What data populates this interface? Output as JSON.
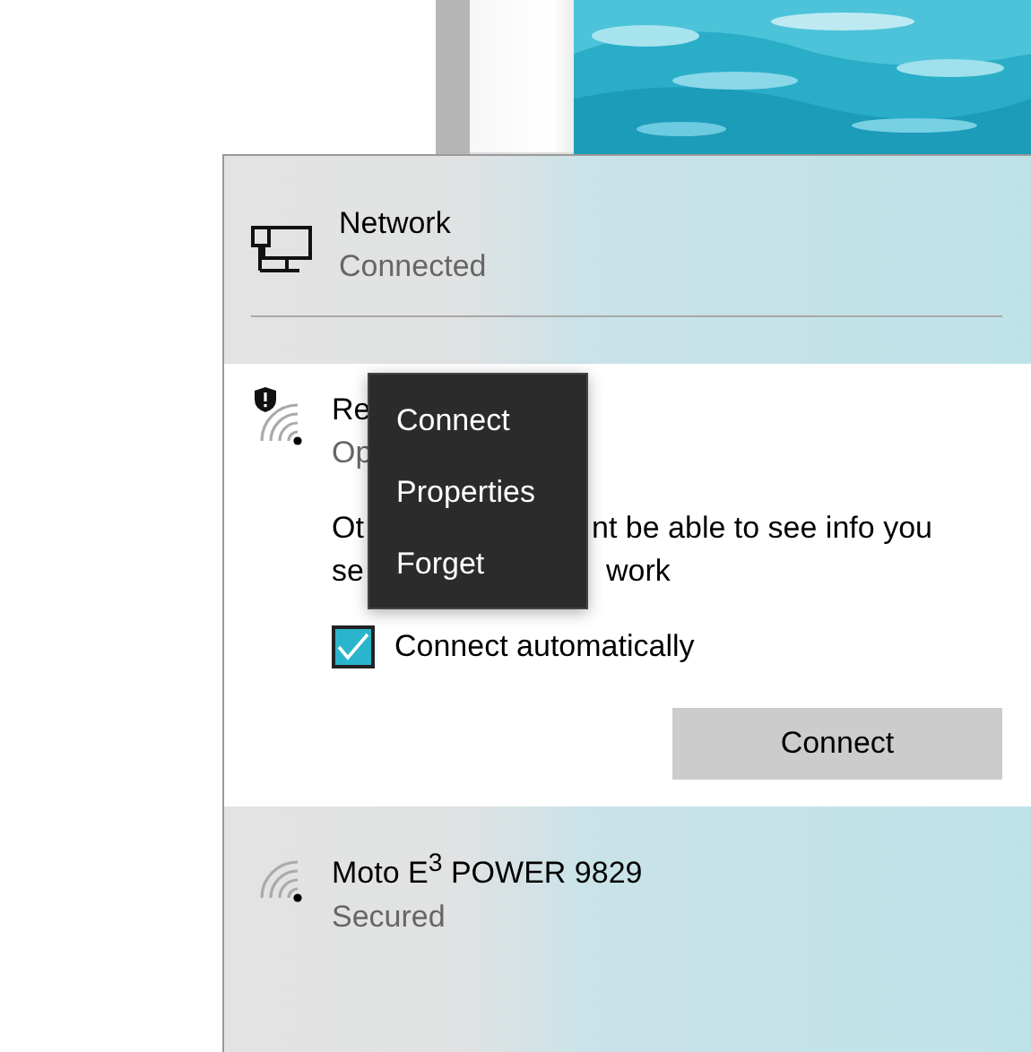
{
  "connected_network": {
    "name": "Network",
    "status": "Connected"
  },
  "expanded_network": {
    "name": "Re",
    "status": "Op",
    "unsecured": true,
    "warning": [
      {
        "left": "Ot",
        "right": "nt be able to see info you"
      },
      {
        "left": "se",
        "right": "work"
      }
    ],
    "connect_automatically": {
      "label": "Connect automatically",
      "checked": true
    },
    "button": "Connect"
  },
  "context_menu": {
    "items": [
      "Connect",
      "Properties",
      "Forget"
    ]
  },
  "networks": [
    {
      "name": "Moto E$^{3}$ POWER 9829",
      "status": "Secured",
      "unsecured": false
    }
  ]
}
